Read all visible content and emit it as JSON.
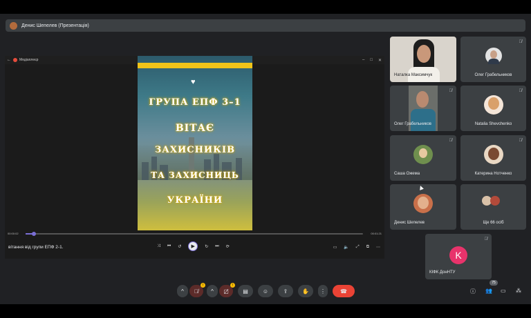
{
  "presenter": {
    "label": "Денис Шепелев (Презентація)"
  },
  "player": {
    "app_title": "Медіаплеєр",
    "time_current": "00:00:02",
    "time_total": "00:01:21",
    "progress": 0.025,
    "caption": "вітання від групи ЕПФ 2-1.",
    "video_lines": [
      "ГРУПА ЕПФ 3–1",
      "ВІТАЄ",
      "ЗАХИСНИКІВ",
      "ТА ЗАХИСНИЦЬ",
      "УКРАЇНИ"
    ]
  },
  "participants": [
    {
      "name": "Наталка Максимчук"
    },
    {
      "name": "Олег Грабельников"
    },
    {
      "name": "Олег Грабельников"
    },
    {
      "name": "Natalia Shevchenko"
    },
    {
      "name": "Саша Ожема"
    },
    {
      "name": "Катерина Нотченко"
    },
    {
      "name": "Денис Шепелев"
    },
    {
      "name": "Ще 66 осіб"
    },
    {
      "name": "КІФК ДонНТУ",
      "initial": "K"
    }
  ],
  "participant_count": "75",
  "colors": {
    "accent": "#7b6fd6",
    "end_call": "#ea4335",
    "kifk_avatar": "#e8336b"
  }
}
